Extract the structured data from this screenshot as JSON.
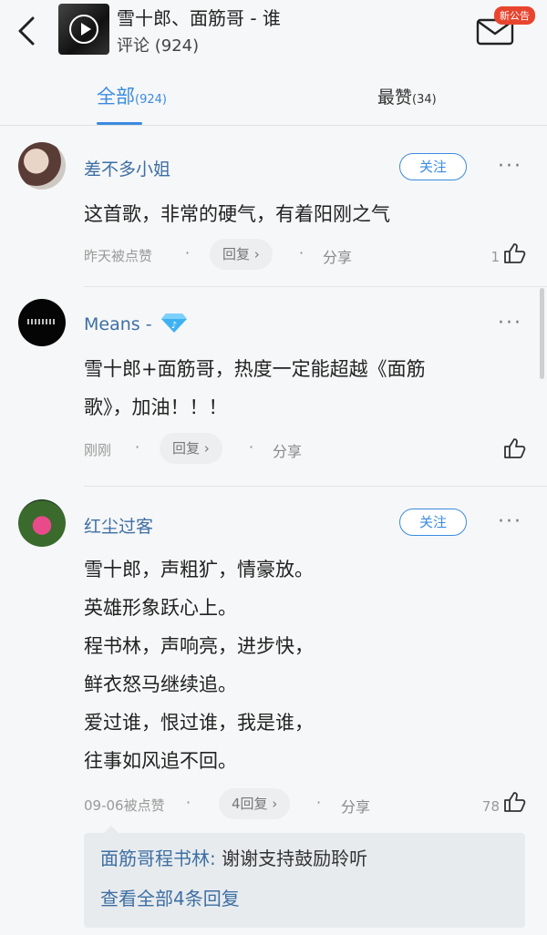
{
  "header": {
    "song_title": "雪十郎、面筋哥 - 谁",
    "comments_label": "评论",
    "comments_count": "(924)",
    "notice_badge": "新公告",
    "icons": {
      "back": "back-arrow-icon",
      "mail": "mail-icon",
      "play": "play-icon"
    }
  },
  "tabs": {
    "all_label": "全部",
    "all_count": "(924)",
    "top_label": "最赞",
    "top_count": "(34)"
  },
  "comments": [
    {
      "user": "差不多小姐",
      "follow": "关注",
      "content_lines": [
        "这首歌，非常的硬气，有着阳刚之气"
      ],
      "time": "昨天被点赞",
      "reply": "回复 ›",
      "share": "分享",
      "likes": "1"
    },
    {
      "user": "Means -",
      "content_lines": [
        "雪十郎+面筋哥，热度一定能超越《面筋",
        "歌》，加油！！！"
      ],
      "time": "刚刚",
      "reply": "回复 ›",
      "share": "分享",
      "likes": ""
    },
    {
      "user": "红尘过客",
      "follow": "关注",
      "content_lines": [
        "雪十郎，声粗犷，情豪放。",
        "英雄形象跃心上。",
        "程书林，声响亮，进步快，",
        "鲜衣怒马继续追。",
        "爱过谁，恨过谁，我是谁，",
        "往事如风追不回。"
      ],
      "time": "09-06被点赞",
      "reply": "4回复 ›",
      "share": "分享",
      "likes": "78",
      "sub_reply": {
        "author": "面筋哥程书林:",
        "text": "谢谢支持鼓励聆听",
        "view_all": "查看全部4条回复"
      }
    }
  ],
  "colors": {
    "accent": "#3b8be0",
    "username": "#3d6fa3",
    "badge": "#e8452f"
  }
}
